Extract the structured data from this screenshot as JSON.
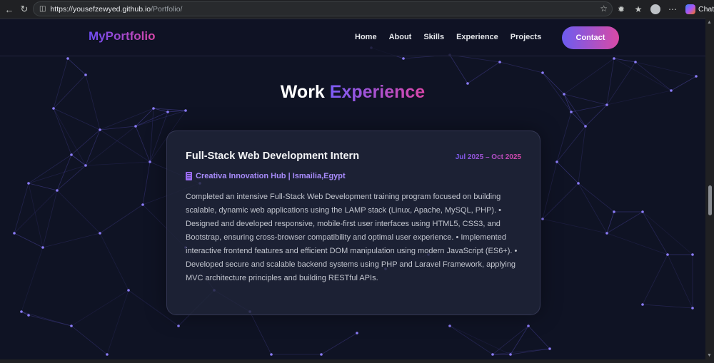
{
  "browser": {
    "url_host": "https://yousefzewyed.github.io",
    "url_path": "/Portfolio/",
    "chat_label": "Chat"
  },
  "nav": {
    "logo": "MyPortfolio",
    "links": [
      "Home",
      "About",
      "Skills",
      "Experience",
      "Projects"
    ],
    "contact": "Contact"
  },
  "section": {
    "title_plain": "Work",
    "title_accent": "Experience"
  },
  "experience": {
    "title": "Full-Stack Web Development Intern",
    "date": "Jul 2025 – Oct 2025",
    "company": "Creativa Innovation Hub | Ismailia,Egypt",
    "description": "Completed an intensive Full-Stack Web Development training program focused on building scalable, dynamic web applications using the LAMP stack (Linux, Apache, MySQL, PHP). • Designed and developed responsive, mobile-first user interfaces using HTML5, CSS3, and Bootstrap, ensuring cross-browser compatibility and optimal user experience. • Implemented interactive frontend features and efficient DOM manipulation using modern JavaScript (ES6+). • Developed secure and scalable backend systems using PHP and Laravel Framework, applying MVC architecture principles and building RESTful APIs."
  },
  "colors": {
    "accent_start": "#6d4cf5",
    "accent_end": "#d946a8",
    "background": "#0f1324",
    "network_line": "#6a5ee0"
  }
}
